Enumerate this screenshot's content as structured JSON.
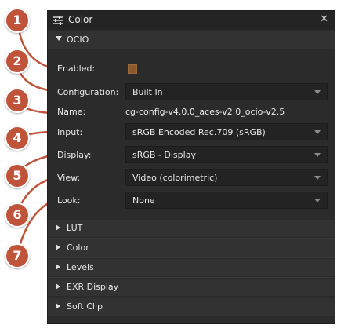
{
  "window": {
    "title": "Color",
    "close_glyph": "✕"
  },
  "ocio": {
    "header": "OCIO",
    "enabled_label": "Enabled:",
    "enabled_checked": true,
    "configuration_label": "Configuration:",
    "configuration_value": "Built In",
    "name_label": "Name:",
    "name_value": "cg-config-v4.0.0_aces-v2.0_ocio-v2.5",
    "input_label": "Input:",
    "input_value": "sRGB Encoded Rec.709 (sRGB)",
    "display_label": "Display:",
    "display_value": "sRGB - Display",
    "view_label": "View:",
    "view_value": "Video (colorimetric)",
    "look_label": "Look:",
    "look_value": "None"
  },
  "sections": [
    "LUT",
    "Color",
    "Levels",
    "EXR Display",
    "Soft Clip"
  ],
  "callouts": [
    "1",
    "2",
    "3",
    "4",
    "5",
    "6",
    "7"
  ],
  "colors": {
    "accent": "#c0543a",
    "panel": "#2b2b2b",
    "checkbox": "#8a5a2e"
  },
  "icons": {
    "title": "sliders-icon",
    "close": "close-icon"
  }
}
